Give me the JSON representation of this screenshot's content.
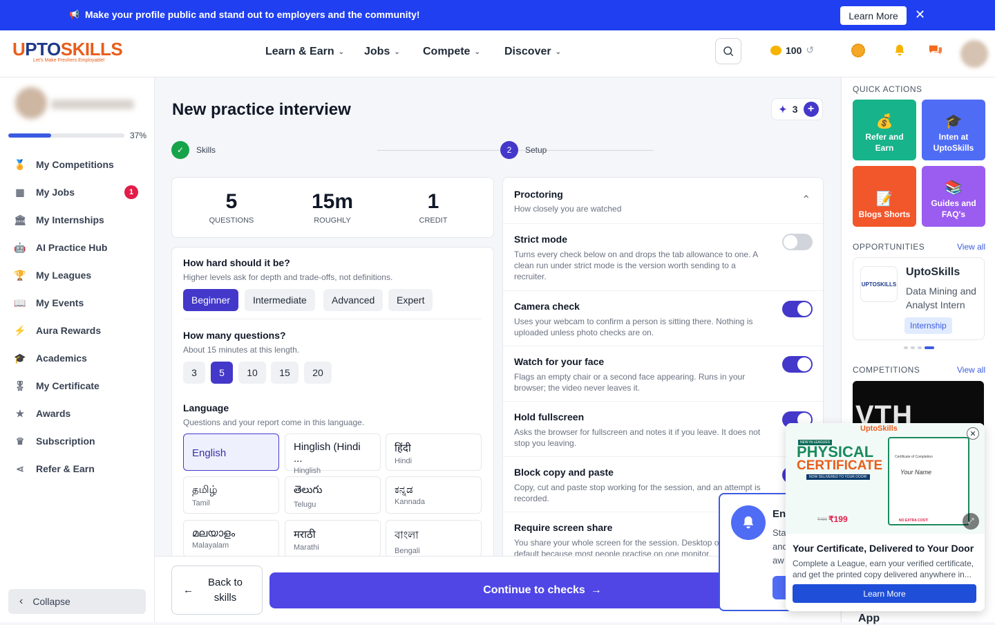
{
  "banner": {
    "message": "Make your profile public and stand out to employers and the community!",
    "button": "Learn More",
    "close": "✕"
  },
  "header": {
    "logo_text": "UPTOSKILLS",
    "logo_tagline": "Let's Make Freshers Employable!",
    "nav": [
      "Learn & Earn",
      "Jobs",
      "Compete",
      "Discover"
    ],
    "coins": "100"
  },
  "sidebar": {
    "progress_pct": 37,
    "progress_label": "37%",
    "items": [
      {
        "label": "My Competitions",
        "icon": "trophy-cup-icon"
      },
      {
        "label": "My Jobs",
        "icon": "briefcase-icon",
        "badge": "1"
      },
      {
        "label": "My Internships",
        "icon": "building-icon"
      },
      {
        "label": "AI Practice Hub",
        "icon": "robot-icon"
      },
      {
        "label": "My Leagues",
        "icon": "trophy-icon"
      },
      {
        "label": "My Events",
        "icon": "book-icon"
      },
      {
        "label": "Aura Rewards",
        "icon": "bolt-icon"
      },
      {
        "label": "Academics",
        "icon": "graduation-cap-icon"
      },
      {
        "label": "My Certificate",
        "icon": "certificate-icon"
      },
      {
        "label": "Awards",
        "icon": "star-icon"
      },
      {
        "label": "Subscription",
        "icon": "crown-icon"
      },
      {
        "label": "Refer & Earn",
        "icon": "share-icon"
      }
    ],
    "collapse": "Collapse"
  },
  "main": {
    "title": "New practice interview",
    "credits": "3",
    "steps": [
      {
        "label": "Skills",
        "state": "done"
      },
      {
        "label": "Setup",
        "num": "2",
        "state": "active"
      }
    ],
    "stats": [
      {
        "value": "5",
        "label": "QUESTIONS"
      },
      {
        "value": "15m",
        "label": "ROUGHLY"
      },
      {
        "value": "1",
        "label": "CREDIT"
      }
    ],
    "difficulty": {
      "title": "How hard should it be?",
      "subtitle": "Higher levels ask for depth and trade-offs, not definitions.",
      "options": [
        "Beginner",
        "Intermediate",
        "Advanced",
        "Expert"
      ],
      "selected": "Beginner"
    },
    "questions": {
      "title": "How many questions?",
      "subtitle": "About 15 minutes at this length.",
      "options": [
        "3",
        "5",
        "10",
        "15",
        "20"
      ],
      "selected": "5"
    },
    "language": {
      "title": "Language",
      "subtitle": "Questions and your report come in this language.",
      "options": [
        {
          "name": "English",
          "sub": ""
        },
        {
          "name": "Hinglish (Hindi ...",
          "sub": "Hinglish"
        },
        {
          "name": "हिंदी",
          "sub": "Hindi"
        },
        {
          "name": "தமிழ்",
          "sub": "Tamil"
        },
        {
          "name": "తెలుగు",
          "sub": "Telugu"
        },
        {
          "name": "ಕನ್ನಡ",
          "sub": "Kannada"
        },
        {
          "name": "മലയാളം",
          "sub": "Malayalam"
        },
        {
          "name": "मराठी",
          "sub": "Marathi"
        },
        {
          "name": "বাংলা",
          "sub": "Bengali"
        }
      ],
      "selected": "English"
    },
    "proctoring": {
      "title": "Proctoring",
      "subtitle": "How closely you are watched",
      "items": [
        {
          "title": "Strict mode",
          "desc": "Turns every check below on and drops the tab allowance to one. A clean run under strict mode is the version worth sending to a recruiter.",
          "on": false
        },
        {
          "title": "Camera check",
          "desc": "Uses your webcam to confirm a person is sitting there. Nothing is uploaded unless photo checks are on.",
          "on": true
        },
        {
          "title": "Watch for your face",
          "desc": "Flags an empty chair or a second face appearing. Runs in your browser; the video never leaves it.",
          "on": true
        },
        {
          "title": "Hold fullscreen",
          "desc": "Asks the browser for fullscreen and notes it if you leave. It does not stop you leaving.",
          "on": true
        },
        {
          "title": "Block copy and paste",
          "desc": "Copy, cut and paste stop working for the session, and an attempt is recorded.",
          "on": true
        },
        {
          "title": "Require screen share",
          "desc": "You share your whole screen for the session. Desktop only. Off by default because most people practise on one monitor.",
          "on": false
        }
      ]
    },
    "back_button": "Back to skills",
    "continue_button": "Continue to checks"
  },
  "right": {
    "quick_actions_title": "QUICK ACTIONS",
    "quick_actions": [
      {
        "label": "Refer and Earn",
        "color": "#17b38a",
        "icon": "money-bag-icon"
      },
      {
        "label": "Inten at UptoSkills",
        "color": "#4f6cf5",
        "icon": "graduation-cap-icon"
      },
      {
        "label": "Blogs Shorts",
        "color": "#f2572b",
        "icon": "document-icon"
      },
      {
        "label": "Guides and FAQ's",
        "color": "#9b5cf0",
        "icon": "books-icon"
      }
    ],
    "opportunities_title": "OPPORTUNITIES",
    "view_all": "View all",
    "opportunity": {
      "company": "UptoSkills",
      "role": "Data Mining and Analyst Intern",
      "tag": "Internship"
    },
    "competitions_title": "COMPETITIONS",
    "competition_banner_text": "VTH",
    "app_text": "App"
  },
  "notification_partial": {
    "title": "En",
    "lines": [
      "Sta",
      "and",
      "aw"
    ]
  },
  "popup": {
    "brand": "UptoSkills",
    "promo_badge": "NEW IN LEAGUES",
    "promo_title_1": "PHYSICAL",
    "promo_title_2": "CERTIFICATE",
    "promo_ribbon": "NOW DELIVERED TO YOUR DOOR!",
    "price_old": "₹499",
    "price_new": "₹199",
    "cert_label": "Certificate of Completion",
    "cert_name": "Your Name",
    "delivery_note": "NO EXTRA COST!",
    "title": "Your Certificate, Delivered to Your Door",
    "desc": "Complete a League, earn your verified certificate, and get the printed copy delivered anywhere in...",
    "button": "Learn More"
  }
}
